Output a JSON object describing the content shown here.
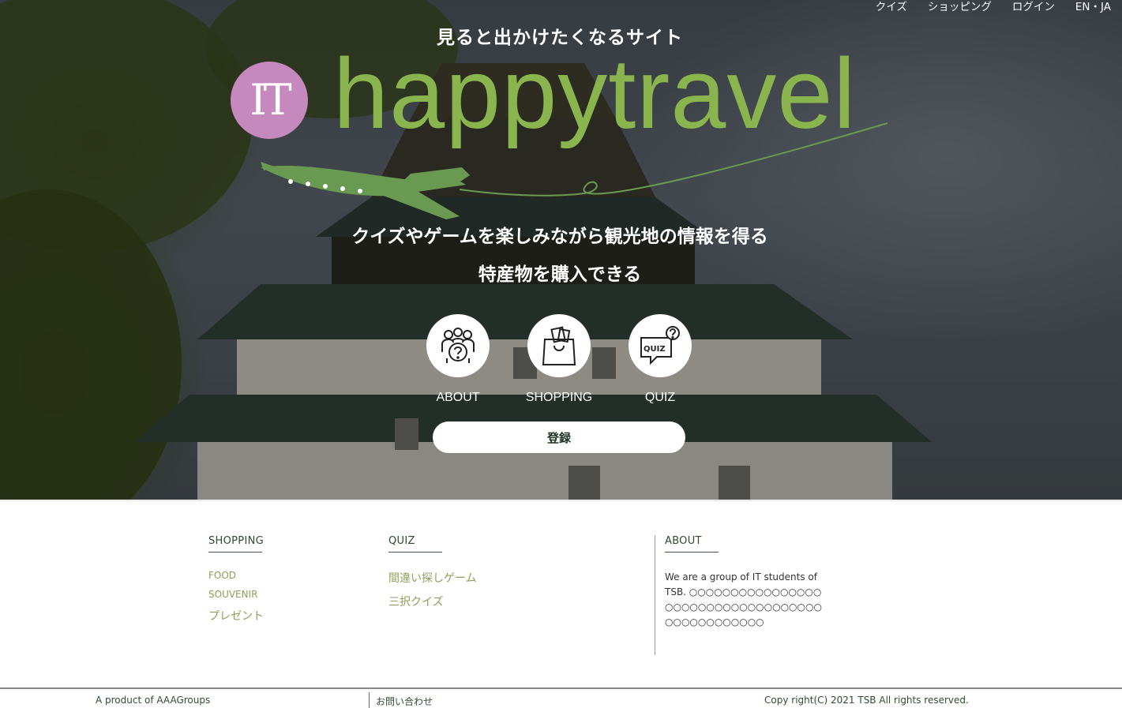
{
  "nav": {
    "items": [
      "クイズ",
      "ショッピング",
      "ログイン"
    ],
    "lang": "EN・JA"
  },
  "hero": {
    "tagline": "見ると出かけたくなるサイト",
    "logo_mark": "IT",
    "brand": "happytravel",
    "subtitle1": "クイズやゲームを楽しみながら観光地の情報を得る",
    "subtitle2": "特産物を購入できる",
    "features": [
      {
        "label": "ABOUT",
        "icon": "group-question-icon"
      },
      {
        "label": "SHOPPING",
        "icon": "shopping-bag-icon"
      },
      {
        "label": "QUIZ",
        "icon": "quiz-bubble-icon"
      }
    ],
    "register_label": "登録"
  },
  "footer": {
    "shopping": {
      "title": "SHOPPING",
      "items": [
        "FOOD",
        "SOUVENIR",
        "プレゼント"
      ]
    },
    "quiz": {
      "title": "QUIZ",
      "items": [
        "間違い探しゲーム",
        "三択クイズ"
      ]
    },
    "about": {
      "title": "ABOUT",
      "text": "We are a group of IT students of TSB. ○○○○○○○○○○○○○○○○○○○○○○○○○○○○○○○○○○○○○○○○○○○○○○○"
    },
    "product": "A product of AAAGroups",
    "contact": "お問い合わせ",
    "copyright": "Copy right(C) 2021 TSB All rights reserved."
  },
  "colors": {
    "brand_green": "#8ab44e",
    "logo_pink": "#c589bd",
    "plane_green": "#6a9a52",
    "footer_link": "#8ba05a"
  }
}
